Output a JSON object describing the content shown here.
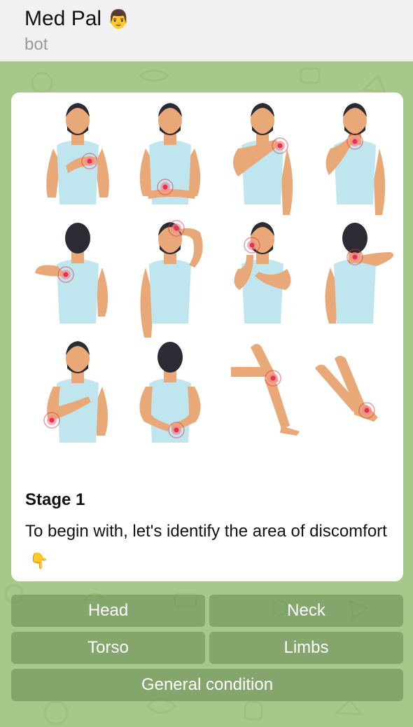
{
  "header": {
    "title": "Med Pal",
    "title_emoji": "👨",
    "subtitle": "bot"
  },
  "message": {
    "image_icon": "body-pain-areas-illustration",
    "stage_title": "Stage 1",
    "text": "To begin with, let's identify the area of discomfort",
    "text_emoji": "👇"
  },
  "keyboard": {
    "rows": [
      [
        "Head",
        "Neck"
      ],
      [
        "Torso",
        "Limbs"
      ],
      [
        "General condition"
      ]
    ]
  },
  "colors": {
    "chat_bg": "#a6c98b",
    "skin": "#e8a877",
    "shirt": "#bfe6ef",
    "hair": "#2c2a33",
    "pain": "#e8304a"
  }
}
